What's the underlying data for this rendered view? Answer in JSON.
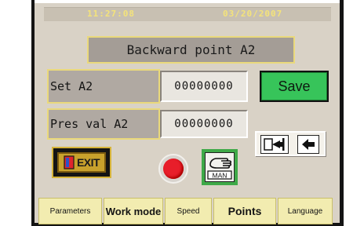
{
  "status_bar": {
    "time": "11:27:08",
    "date": "03/20/2007"
  },
  "title": "Backward point A2",
  "rows": [
    {
      "label": "Set A2",
      "value": "00000000"
    },
    {
      "label": "Pres val A2",
      "value": "00000000"
    }
  ],
  "buttons": {
    "save": "Save",
    "exit": "EXIT",
    "man": "MAN"
  },
  "icons": {
    "exit": "exit-door-icon",
    "lamp": "red-status-lamp-icon",
    "man": "manual-hand-icon",
    "go_to_position": "go-to-position-icon",
    "back": "back-arrow-icon"
  },
  "tabs": [
    {
      "label": "Parameters"
    },
    {
      "label": "Work mode"
    },
    {
      "label": "Speed"
    },
    {
      "label": "Points",
      "active": true
    },
    {
      "label": "Language"
    }
  ],
  "colors": {
    "screen_bg": "#d9d2c6",
    "save_green": "#37c45a",
    "lamp_red": "#e81e2a",
    "tab_yellow": "#f2ecb0",
    "frame_yellow": "#ead97b"
  }
}
